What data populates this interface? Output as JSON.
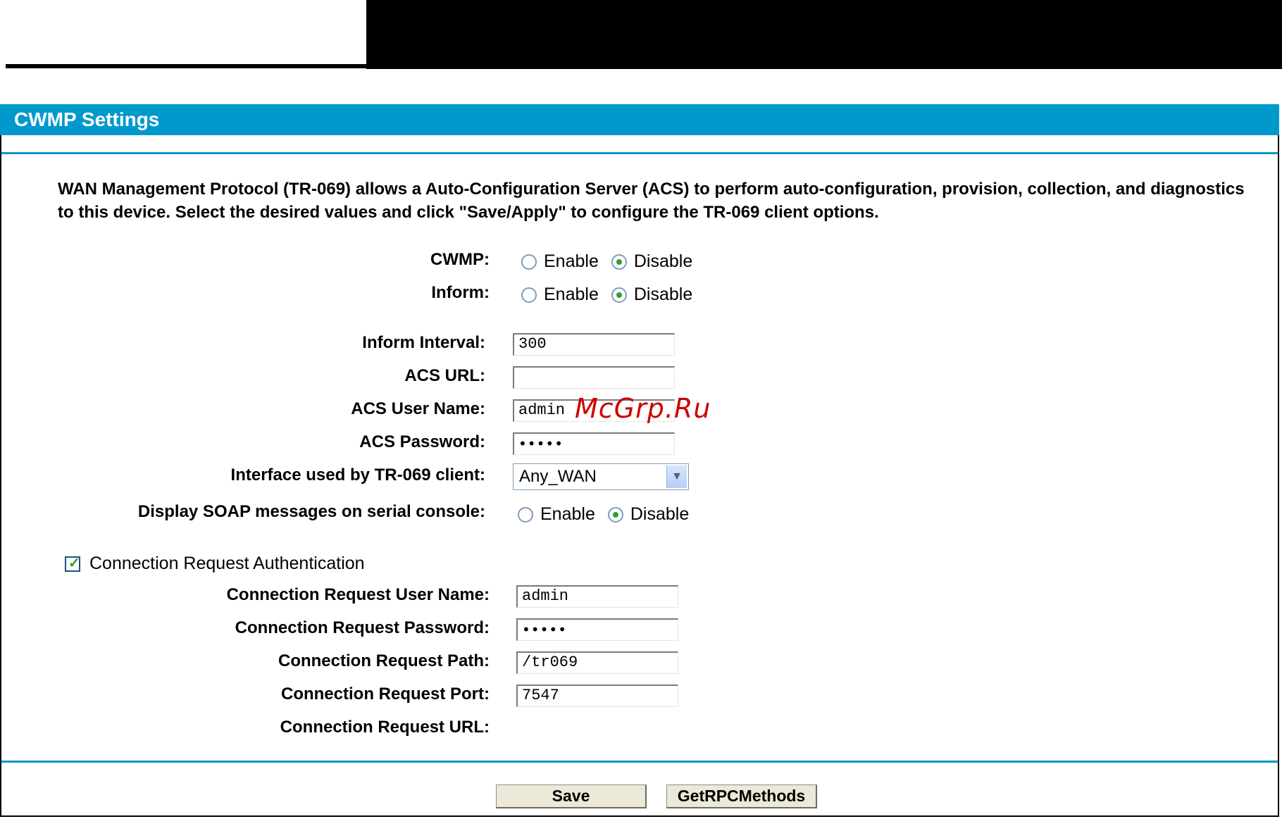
{
  "header": {
    "title": "CWMP Settings"
  },
  "intro_text": "WAN Management Protocol (TR-069) allows a Auto-Configuration Server (ACS) to perform auto-configuration, provision, collection, and diagnostics to this device. Select the desired values and click \"Save/Apply\" to configure the TR-069 client options.",
  "cwmp": {
    "label": "CWMP:",
    "enable": "Enable",
    "disable": "Disable",
    "selected": "Disable"
  },
  "inform": {
    "label": "Inform:",
    "enable": "Enable",
    "disable": "Disable",
    "selected": "Disable"
  },
  "inform_interval": {
    "label": "Inform Interval:",
    "value": "300"
  },
  "acs_url": {
    "label": "ACS URL:",
    "value": ""
  },
  "acs_user": {
    "label": "ACS User Name:",
    "value": "admin"
  },
  "acs_password": {
    "label": "ACS Password:",
    "value": "•••••"
  },
  "interface": {
    "label": "Interface used by TR-069 client:",
    "value": "Any_WAN"
  },
  "soap": {
    "label": "Display SOAP messages on serial console:",
    "enable": "Enable",
    "disable": "Disable",
    "selected": "Disable"
  },
  "conn_auth": {
    "label": "Connection Request Authentication",
    "checked": true
  },
  "conn_user": {
    "label": "Connection Request User Name:",
    "value": "admin"
  },
  "conn_password": {
    "label": "Connection Request Password:",
    "value": "•••••"
  },
  "conn_path": {
    "label": "Connection Request Path:",
    "value": "/tr069"
  },
  "conn_port": {
    "label": "Connection Request Port:",
    "value": "7547"
  },
  "conn_url": {
    "label": "Connection Request URL:"
  },
  "buttons": {
    "save": "Save",
    "rpc": "GetRPCMethods"
  },
  "watermark": "McGrp.Ru",
  "colors": {
    "header_blue": "#0099cc",
    "radio_dot": "#2fa02f"
  }
}
